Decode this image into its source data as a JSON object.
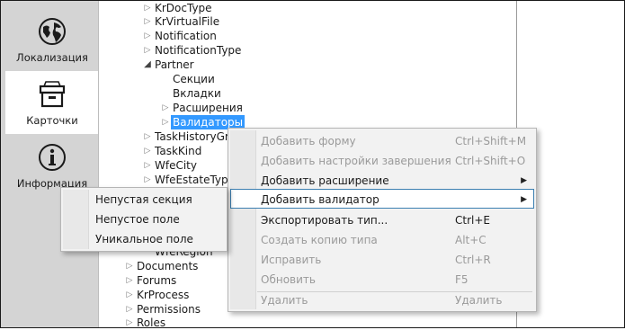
{
  "nav": {
    "items": [
      {
        "label": "Локализация",
        "icon": "globe-icon"
      },
      {
        "label": "Карточки",
        "icon": "box-icon"
      },
      {
        "label": "Информация",
        "icon": "info-icon"
      }
    ]
  },
  "tree": {
    "items": [
      {
        "label": "KrDocType",
        "arrow": "collapsed"
      },
      {
        "label": "KrVirtualFile",
        "arrow": "collapsed"
      },
      {
        "label": "Notification",
        "arrow": "collapsed"
      },
      {
        "label": "NotificationType",
        "arrow": "collapsed"
      },
      {
        "label": "Partner",
        "arrow": "expanded"
      },
      {
        "label": "Секции",
        "arrow": "none"
      },
      {
        "label": "Вкладки",
        "arrow": "none"
      },
      {
        "label": "Расширения",
        "arrow": "collapsed"
      },
      {
        "label": "Валидаторы",
        "arrow": "collapsed"
      },
      {
        "label": "TaskHistoryGroupType",
        "arrow": "collapsed"
      },
      {
        "label": "TaskKind",
        "arrow": "collapsed"
      },
      {
        "label": "WfeCity",
        "arrow": "collapsed"
      },
      {
        "label": "WfeEstateType",
        "arrow": "collapsed"
      },
      {
        "label": "WfeRegion",
        "arrow": "none"
      },
      {
        "label": "Documents",
        "arrow": "collapsed"
      },
      {
        "label": "Forums",
        "arrow": "collapsed"
      },
      {
        "label": "KrProcess",
        "arrow": "collapsed"
      },
      {
        "label": "Permissions",
        "arrow": "collapsed"
      },
      {
        "label": "Roles",
        "arrow": "collapsed"
      }
    ]
  },
  "context_menu": {
    "items": [
      {
        "label": "Добавить форму",
        "shortcut": "Ctrl+Shift+M",
        "enabled": false
      },
      {
        "label": "Добавить настройки завершения",
        "shortcut": "Ctrl+Shift+O",
        "enabled": false
      },
      {
        "label": "Добавить расширение",
        "shortcut": "",
        "enabled": true
      },
      {
        "label": "Добавить валидатор",
        "shortcut": "",
        "enabled": true
      },
      {
        "label": "Экспортировать тип...",
        "shortcut": "Ctrl+E",
        "enabled": true
      },
      {
        "label": "Создать копию типа",
        "shortcut": "Alt+C",
        "enabled": false
      },
      {
        "label": "Исправить",
        "shortcut": "Ctrl+R",
        "enabled": false
      },
      {
        "label": "Обновить",
        "shortcut": "F5",
        "enabled": false
      },
      {
        "label": "Удалить",
        "shortcut": "Удалить",
        "enabled": false
      }
    ],
    "submenu_arrow": "▶"
  },
  "submenu": {
    "items": [
      {
        "label": "Непустая секция"
      },
      {
        "label": "Непустое поле"
      },
      {
        "label": "Уникальное поле"
      }
    ]
  },
  "colors": {
    "selection": "#3399ff",
    "nav_background": "#d4d4d4",
    "menu_background": "#f2f2f2",
    "menu_highlight_border": "#3c7fb1"
  }
}
